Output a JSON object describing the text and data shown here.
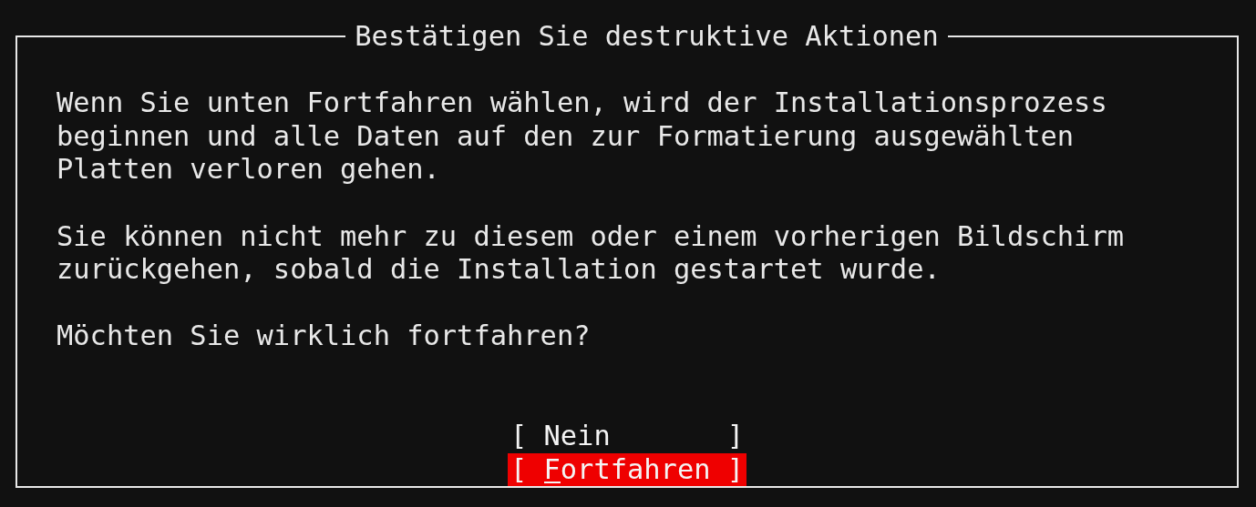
{
  "dialog": {
    "title": "Bestätigen Sie destruktive Aktionen",
    "paragraphs": [
      "Wenn Sie unten Fortfahren wählen, wird der Installationsprozess\nbeginnen und alle Daten auf den zur Formatierung ausgewählten\nPlatten verloren gehen.",
      "Sie können nicht mehr zu diesem oder einem vorherigen Bildschirm\nzurückgehen, sobald die Installation gestartet wurde.",
      "Möchten Sie wirklich fortfahren?"
    ],
    "buttons": [
      {
        "label": "[ Nein       ]",
        "selected": false
      },
      {
        "label": "[ Fortfahren ]",
        "selected": true
      }
    ]
  }
}
